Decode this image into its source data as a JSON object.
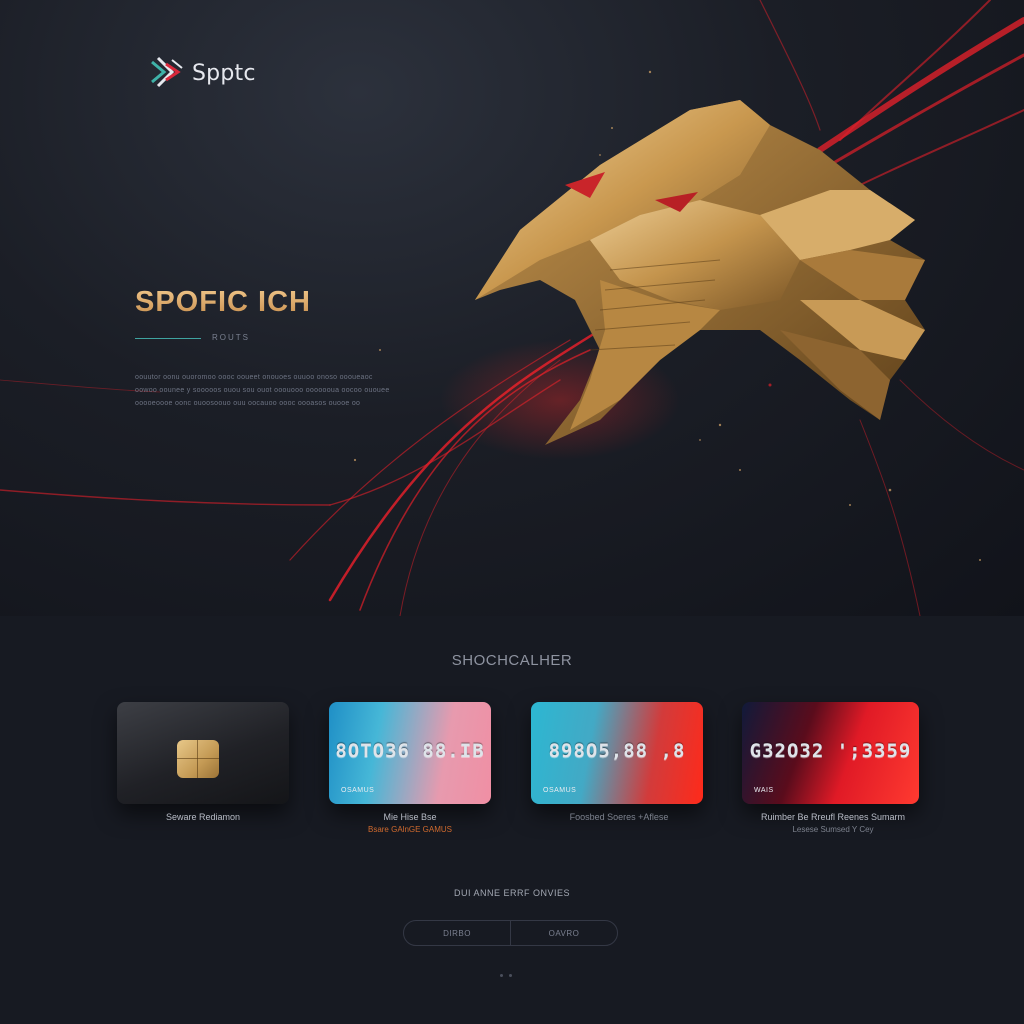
{
  "brand": {
    "name": "Spptc",
    "logo_icon": "stacked-chevrons-icon"
  },
  "hero": {
    "title": "SPOFIC ICH",
    "eyebrow": "ROUTS",
    "description": "oouutor oonu ouoromoo oooc ooueet onouoes ouuoo onoso oooueaoc oowoo oounee y sooooos ouou sou ouot ooouooo ooooooua oocoo ououee ooooeoooe oonc ouoosoouo ouu oocauoo oooc oooasos ouooe oo",
    "art_icon": "golden-eagle-head-icon"
  },
  "section": {
    "title": "SHOCHCALHER",
    "cards": [
      {
        "number": "",
        "small": "",
        "caption": "Seware Rediamon",
        "sub": ""
      },
      {
        "number": "8OTO36 88.IB",
        "small": "OSAMUS",
        "caption": "Mie Hise Bse",
        "sub": "Bsare GAlnGE GAMUS"
      },
      {
        "number": "898O5,88 ,8",
        "small": "OSAMUS",
        "caption": "Foosbed Soeres +Aflese",
        "sub": ""
      },
      {
        "number": "G32O32 ';3359",
        "small": "WAIS",
        "caption": "Ruimber Be Rreufl Reenes Sumarm",
        "sub": "Lesese Sumsed Y Cey"
      }
    ],
    "cta_text": "DUI ANNE ERRF ONVIES",
    "buttons": [
      "DIRBO",
      "OAVRO"
    ]
  },
  "colors": {
    "accent_gold": "#d9a86a",
    "accent_red": "#e0202a",
    "accent_teal": "#3fa3a0",
    "background": "#15171e"
  }
}
